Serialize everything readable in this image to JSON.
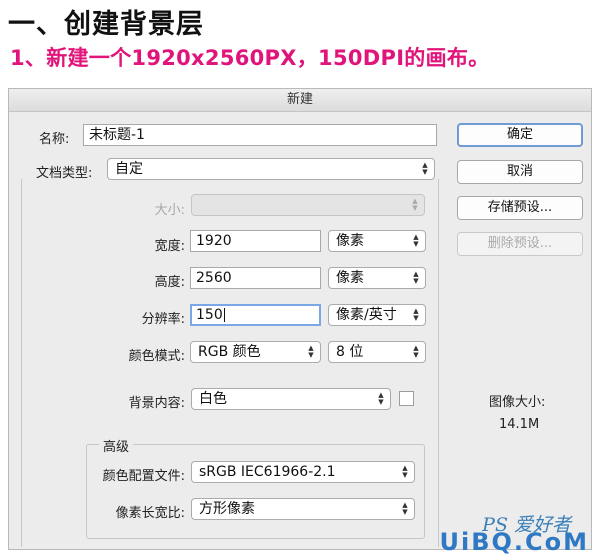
{
  "heading": "一、创建背景层",
  "step": "1、新建一个1920x2560PX，150DPI的画布。",
  "dialog": {
    "title": "新建",
    "name": {
      "label": "名称:",
      "value": "未标题-1"
    },
    "doc_type": {
      "label": "文档类型:",
      "value": "自定"
    },
    "size": {
      "label": "大小:",
      "value": ""
    },
    "width": {
      "label": "宽度:",
      "value": "1920",
      "unit": "像素"
    },
    "height": {
      "label": "高度:",
      "value": "2560",
      "unit": "像素"
    },
    "resolution": {
      "label": "分辨率:",
      "value": "150",
      "unit": "像素/英寸"
    },
    "color_mode": {
      "label": "颜色模式:",
      "value": "RGB 颜色",
      "depth": "8 位"
    },
    "background": {
      "label": "背景内容:",
      "value": "白色"
    },
    "advanced": {
      "title": "高级",
      "color_profile": {
        "label": "颜色配置文件:",
        "value": "sRGB IEC61966-2.1"
      },
      "pixel_aspect": {
        "label": "像素长宽比:",
        "value": "方形像素"
      }
    },
    "buttons": {
      "ok": "确定",
      "cancel": "取消",
      "save_preset": "存储预设...",
      "delete_preset": "删除预设..."
    },
    "image_size": {
      "label": "图像大小:",
      "value": "14.1M"
    }
  },
  "watermark": {
    "line1": "PS 爱好者",
    "line2": "UiBQ.CoM"
  },
  "colors": {
    "step": "#e0147a",
    "default_button_border": "#6f9bd6",
    "focus_border": "#7aa7e6"
  },
  "icons": {
    "select_arrow": "updown-chevron-icon"
  }
}
